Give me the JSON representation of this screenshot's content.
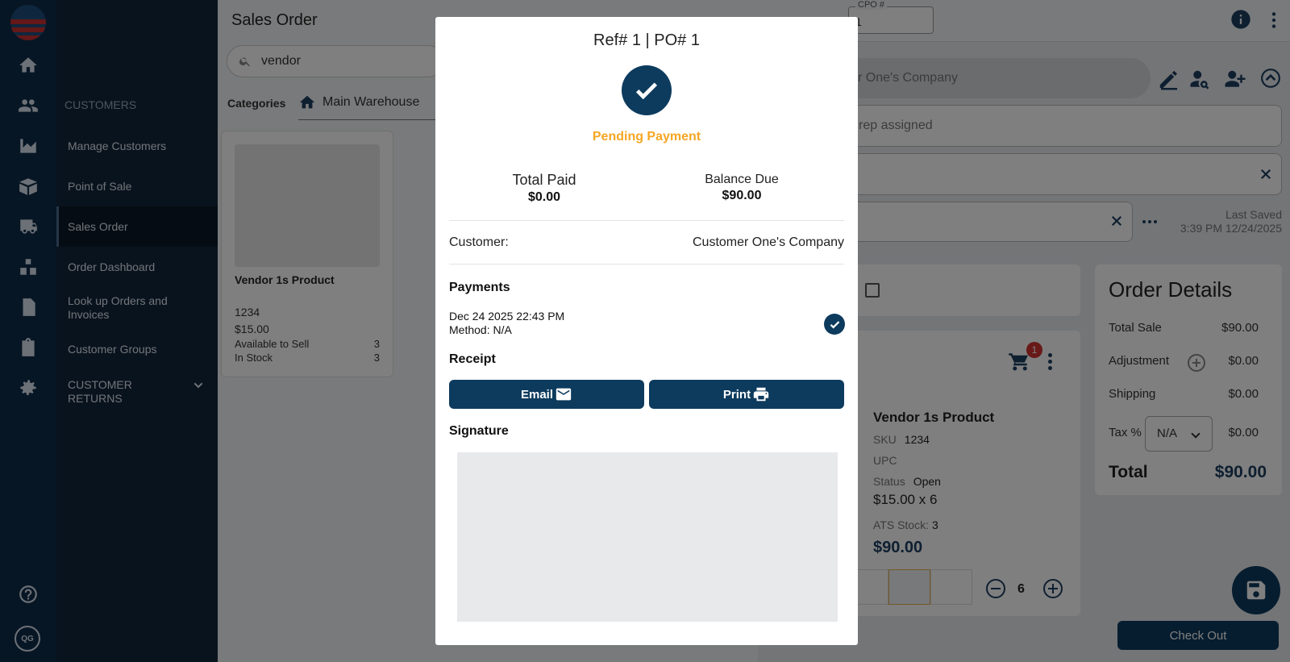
{
  "app": {
    "header_title": "Sales Order",
    "search_value": "vendor",
    "categories_label": "Categories",
    "warehouse_tab": "Main Warehouse",
    "user_initials": "QG"
  },
  "sidebar": {
    "section": "CUSTOMERS",
    "items": [
      {
        "label": "Manage Customers"
      },
      {
        "label": "Point of Sale"
      },
      {
        "label": "Sales Order",
        "active": true
      },
      {
        "label": "Order Dashboard"
      },
      {
        "label": "Look up Orders and Invoices"
      },
      {
        "label": "Customer Groups"
      },
      {
        "label": "CUSTOMER RETURNS"
      }
    ],
    "rail_icons": [
      "home-icon",
      "customers-icon",
      "reports-icon",
      "inventory-icon",
      "shipping-icon",
      "warehouse-icon",
      "invoice-icon",
      "clipboard-icon",
      "settings-icon",
      "help-icon"
    ]
  },
  "product_card": {
    "name": "Vendor 1s Product",
    "sku": "1234",
    "price": "$15.00",
    "available_label": "Available to Sell",
    "available_value": "3",
    "stock_label": "In Stock",
    "stock_value": "3"
  },
  "order": {
    "cpo_label": "CPO #",
    "cpo_value": "1",
    "customer_partial": "r One's Company",
    "rep_partial": "rep assigned",
    "last_saved_label": "Last Saved",
    "last_saved_value": "3:39 PM 12/24/2025",
    "cart_badge": "1",
    "line": {
      "name": "Vendor 1s Product",
      "sku_label": "SKU",
      "sku": "1234",
      "upc_label": "UPC",
      "status_label": "Status",
      "status": "Open",
      "price_qty": "$15.00  x 6",
      "ats_label": "ATS Stock:",
      "ats": "3",
      "total": "$90.00",
      "qty": "6"
    },
    "details": {
      "title": "Order Details",
      "total_sale_label": "Total Sale",
      "total_sale": "$90.00",
      "adjustment_label": "Adjustment",
      "adjustment": "$0.00",
      "shipping_label": "Shipping",
      "shipping": "$0.00",
      "tax_label": "Tax %",
      "tax_select": "N/A",
      "tax": "$0.00",
      "total_label": "Total",
      "total": "$90.00"
    },
    "checkout_label": "Check Out"
  },
  "modal": {
    "title": "Ref# 1 | PO# 1",
    "status": "Pending Payment",
    "total_paid_label": "Total Paid",
    "total_paid": "$0.00",
    "balance_due_label": "Balance Due",
    "balance_due": "$90.00",
    "customer_label": "Customer:",
    "customer_value": "Customer One's Company",
    "payments_heading": "Payments",
    "payment_date": "Dec 24 2025 22:43 PM",
    "payment_method": "Method: N/A",
    "receipt_heading": "Receipt",
    "email_label": "Email",
    "print_label": "Print",
    "signature_heading": "Signature"
  },
  "colors": {
    "primary": "#0d3b5e",
    "pending": "#f5a623",
    "sidebar": "#12273c"
  }
}
